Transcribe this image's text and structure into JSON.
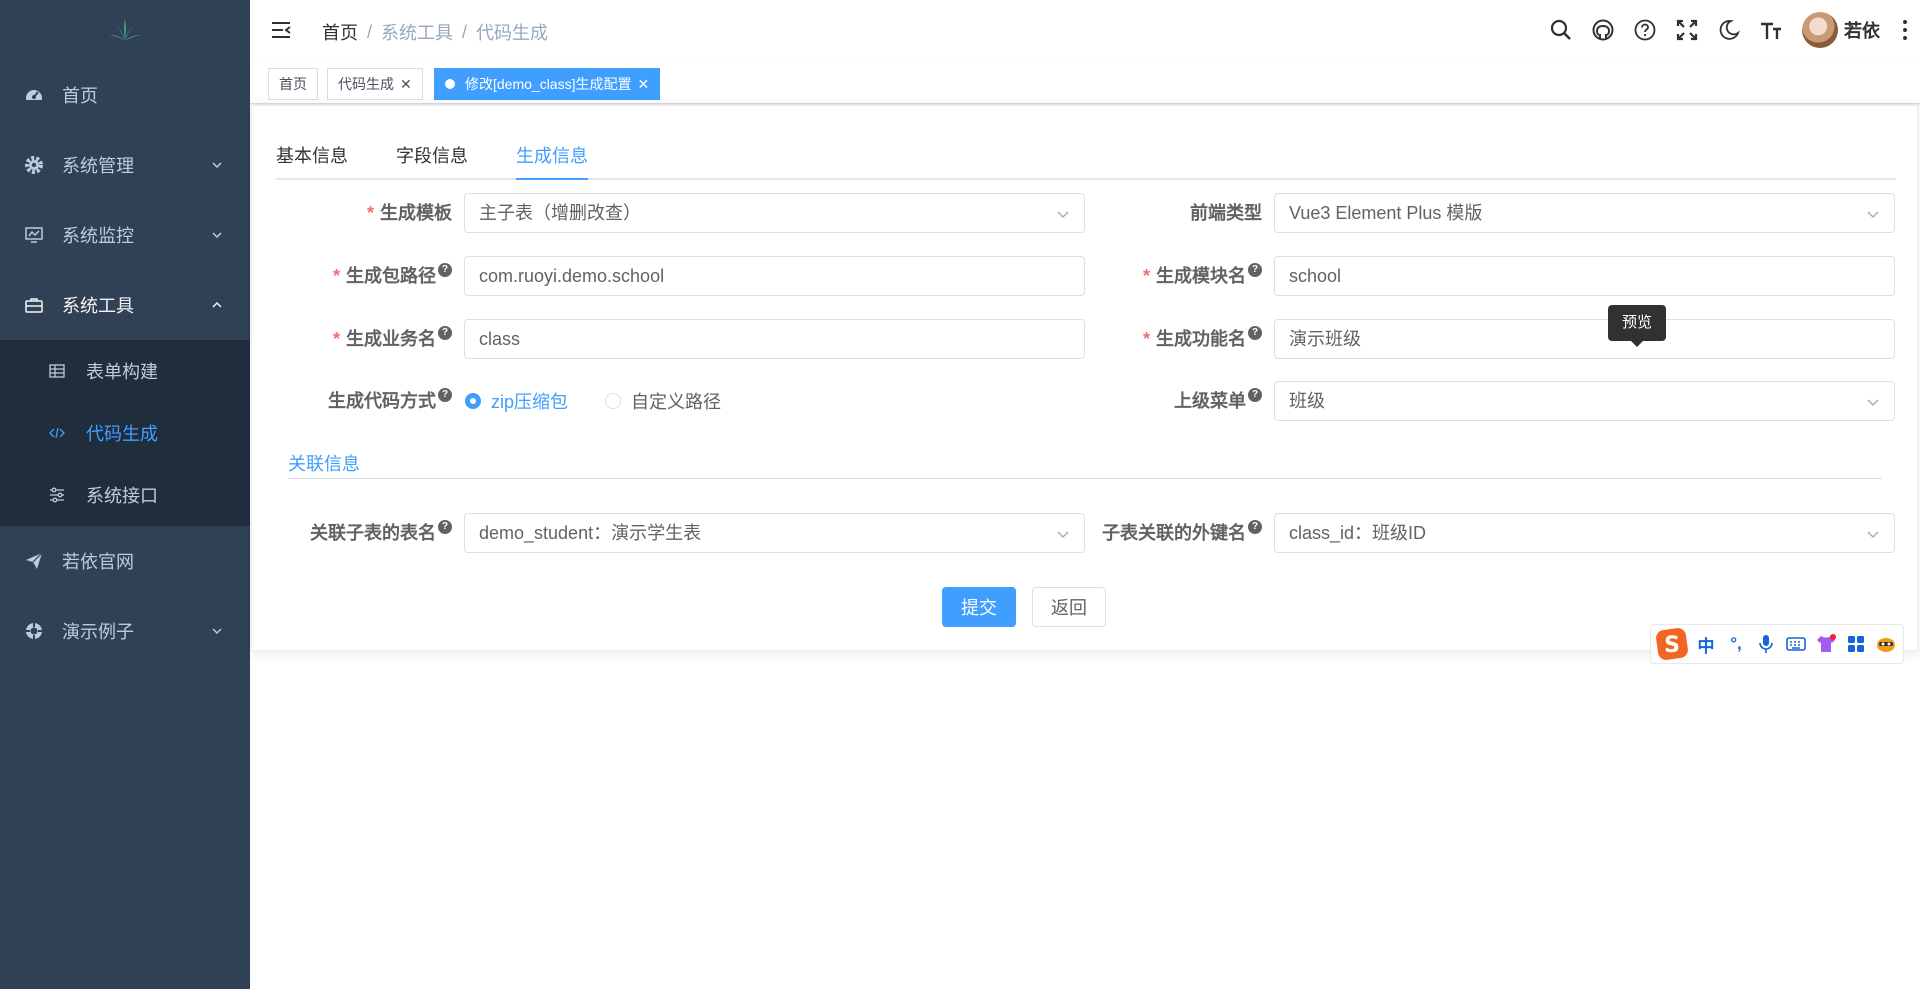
{
  "sidebar": {
    "items": [
      {
        "label": "首页"
      },
      {
        "label": "系统管理"
      },
      {
        "label": "系统监控"
      },
      {
        "label": "系统工具"
      },
      {
        "label": "若依官网"
      },
      {
        "label": "演示例子"
      }
    ],
    "tool_children": [
      {
        "label": "表单构建"
      },
      {
        "label": "代码生成"
      },
      {
        "label": "系统接口"
      }
    ],
    "active_color": "#409eff",
    "bg_color": "#304156"
  },
  "navbar": {
    "breadcrumb": [
      "首页",
      "系统工具",
      "代码生成"
    ],
    "breadcrumb_sep": "/",
    "user_name": "若依"
  },
  "tags": [
    {
      "label": "首页"
    },
    {
      "label": "代码生成"
    },
    {
      "label": "修改[demo_class]生成配置"
    }
  ],
  "tabs": [
    "基本信息",
    "字段信息",
    "生成信息"
  ],
  "form": {
    "tpl_category": {
      "label": "生成模板",
      "value": "主子表（增删改查）"
    },
    "frontend_type": {
      "label": "前端类型",
      "value": "Vue3 Element Plus 模版"
    },
    "package_name": {
      "label": "生成包路径",
      "value": "com.ruoyi.demo.school"
    },
    "module_name": {
      "label": "生成模块名",
      "value": "school"
    },
    "business_name": {
      "label": "生成业务名",
      "value": "class"
    },
    "function_name": {
      "label": "生成功能名",
      "value": "演示班级"
    },
    "gen_type": {
      "label": "生成代码方式",
      "options": [
        "zip压缩包",
        "自定义路径"
      ],
      "selected": "zip压缩包"
    },
    "parent_menu": {
      "label": "上级菜单",
      "value": "班级"
    },
    "section_title": "关联信息",
    "sub_table": {
      "label": "关联子表的表名",
      "value": "demo_student：演示学生表"
    },
    "sub_fk": {
      "label": "子表关联的外键名",
      "value": "class_id：班级ID"
    }
  },
  "buttons": {
    "submit": "提交",
    "back": "返回"
  },
  "tooltip": "预览",
  "ime": {
    "mode": "中",
    "punct": "°,"
  }
}
